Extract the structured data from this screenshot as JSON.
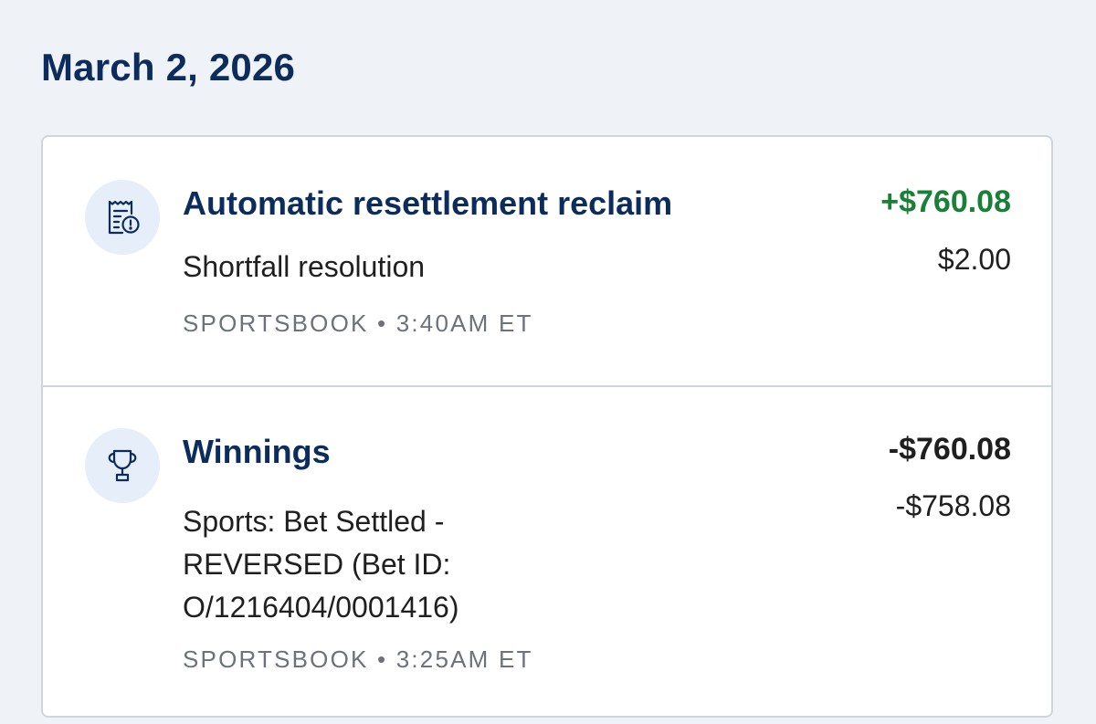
{
  "date_heading": "March 2, 2026",
  "transactions": [
    {
      "icon": "receipt-alert-icon",
      "title": "Automatic resettlement reclaim",
      "description": "Shortfall resolution",
      "meta": "SPORTSBOOK • 3:40AM ET",
      "amount": "+$760.08",
      "amount_color": "#1a7f37",
      "balance": "$2.00"
    },
    {
      "icon": "trophy-icon",
      "title": "Winnings",
      "description": "Sports: Bet Settled - REVERSED (Bet ID: O/1216404/0001416)",
      "meta": "SPORTSBOOK • 3:25AM ET",
      "amount": "-$760.08",
      "amount_color": "#1f1f1f",
      "balance": "-$758.08"
    }
  ],
  "colors": {
    "heading": "#0c2d5c",
    "icon_bg": "#e6eef9",
    "page_bg": "#eff2f7"
  }
}
